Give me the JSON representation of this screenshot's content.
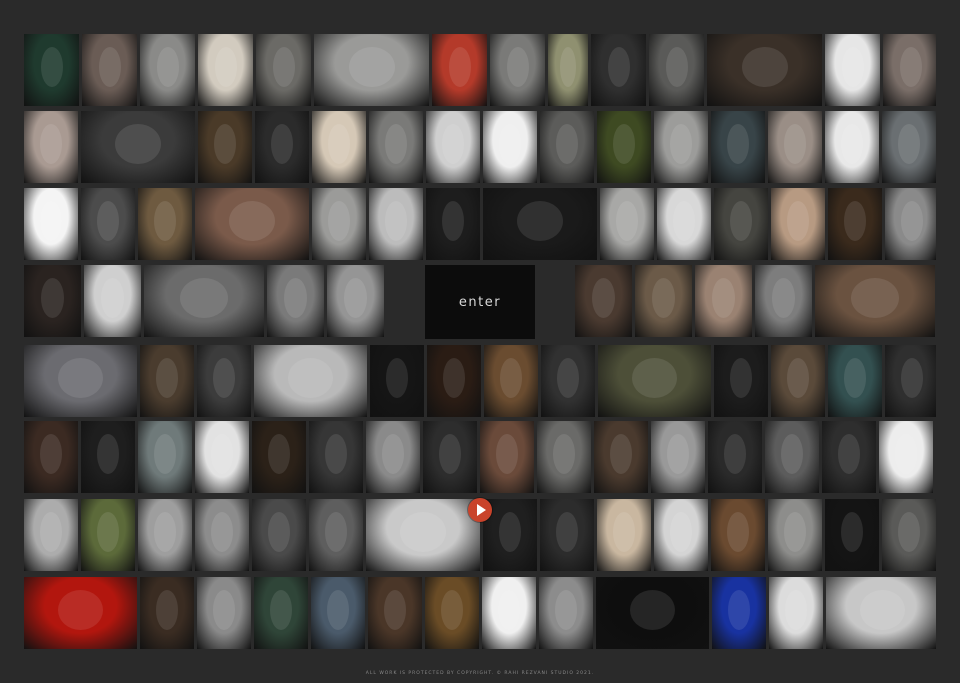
{
  "enter": {
    "label": "enter"
  },
  "footer": {
    "copyright": "ALL WORK IS PROTECTED BY COPYRIGHT. © RAHI REZVANI STUDIO 2021."
  },
  "media": {
    "play_icon": "play-icon",
    "play_color": "#c9432b"
  },
  "rows": [
    [
      "#1f3a2e",
      "#6a5c55",
      "#8a8a88",
      "#d2cbbf",
      "#6b6a66",
      "#9a9a98",
      "#b43a2a",
      "#7a7a78",
      "#8f9070",
      "#2f2f2f",
      "#5a5a58",
      "#3a3028",
      "#e6e6e6",
      "#7a6e68"
    ],
    [
      "#a99a92",
      "#3b3b3b",
      "#4a3a28",
      "#2b2b2b",
      "#d5c8b6",
      "#7a7a78",
      "#cfcfcf",
      "#efefef",
      "#5c5c5a",
      "#3e4a22",
      "#9c9c9a",
      "#384448",
      "#9a8e86",
      "#e8e8e8",
      "#6a6f72"
    ],
    [
      "#f4f4f4",
      "#4c4c4c",
      "#6e5a40",
      "#7a5a4a",
      "#9b9b99",
      "#bcbcbc",
      "#1d1d1d",
      "#1a1a1a",
      "#a8a8a6",
      "#d8d8d8",
      "#454540",
      "#b79a82",
      "#3a2a1c",
      "#8a8a8a"
    ],
    [
      "#2a2320",
      "#cfcfcf",
      "#6b6b6b",
      "#7a7a7a",
      "#959595",
      "#5c5c5c",
      "#8d8d8d",
      "#234428",
      "#4a3a30",
      "#6b5a48",
      "#9a8272",
      "#7d7d7d",
      "#6a5240"
    ],
    [
      "#6b6b70",
      "#4a3c2e",
      "#3c3c3c",
      "#b9b9b9",
      "#151515",
      "#2a1c14",
      "#6a4c30",
      "#313131",
      "#4d4f38",
      "#1c1c1c",
      "#5a4a3a",
      "#335050",
      "#2f2f2f"
    ],
    [
      "#3b2a22",
      "#1e1e1e",
      "#6f7a7a",
      "#e2e2e2",
      "#2b2118",
      "#363636",
      "#8a8a8a",
      "#2d2d2d",
      "#6a4a3a",
      "#6a6a68",
      "#4a3a2e",
      "#999999",
      "#2a2a2a",
      "#5c5c5c",
      "#2e2e2e",
      "#ededed"
    ],
    [
      "#acacac",
      "#5c6a3a",
      "#9e9e9e",
      "#8c8c8c",
      "#4a4a4a",
      "#5e5e5e",
      "#c9c9c9",
      "#1f1f1f",
      "#2c2c2c",
      "#c9b7a0",
      "#d4d4d4",
      "#6a4a30",
      "#8d8d8b",
      "#141414",
      "#5a5a58"
    ],
    [
      "#b2160e",
      "#3a2c22",
      "#8a8a8a",
      "#2f4538",
      "#4a5a6a",
      "#4a3628",
      "#6a4c26",
      "#f0f0f0",
      "#8c8c8c",
      "#0e0e0e",
      "#1832a0",
      "#dcdcdc",
      "#c7c7c7"
    ]
  ]
}
